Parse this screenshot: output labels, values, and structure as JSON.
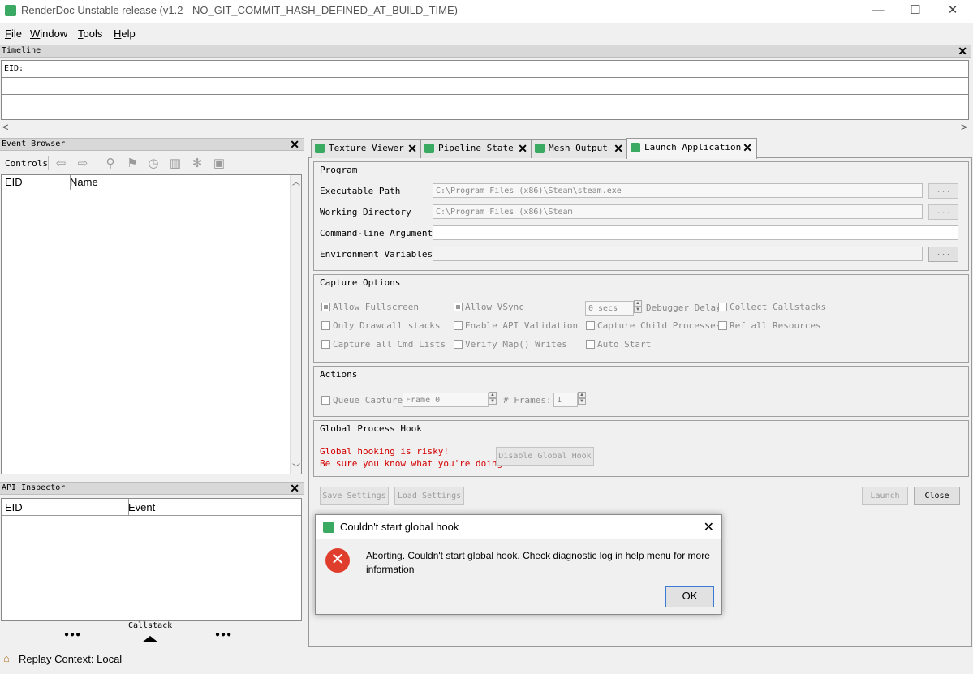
{
  "window": {
    "title": "RenderDoc Unstable release (v1.2 - NO_GIT_COMMIT_HASH_DEFINED_AT_BUILD_TIME)",
    "minimize": "—",
    "maximize": "☐",
    "close": "✕"
  },
  "menu": {
    "file": {
      "mnemonic": "F",
      "rest": "ile"
    },
    "window": {
      "mnemonic": "W",
      "rest": "indow"
    },
    "tools": {
      "mnemonic": "T",
      "rest": "ools"
    },
    "help": {
      "mnemonic": "H",
      "rest": "elp"
    }
  },
  "timeline": {
    "title": "Timeline",
    "eid_label": "EID:",
    "close": "✕",
    "scroll_left": "<",
    "scroll_right": ">"
  },
  "event_browser": {
    "title": "Event Browser",
    "close": "✕",
    "controls_label": "Controls",
    "columns": [
      "EID",
      "Name"
    ]
  },
  "api_inspector": {
    "title": "API Inspector",
    "close": "✕",
    "columns": [
      "EID",
      "Event"
    ],
    "callstack_label": "Callstack",
    "dots": "●●●"
  },
  "tabs": [
    {
      "label": "Texture Viewer",
      "close": "✕"
    },
    {
      "label": "Pipeline State",
      "close": "✕"
    },
    {
      "label": "Mesh Output",
      "close": "✕"
    },
    {
      "label": "Launch Application",
      "close": "✕"
    }
  ],
  "program": {
    "title": "Program",
    "executable_label": "Executable Path",
    "executable_value": "C:\\Program Files (x86)\\Steam\\steam.exe",
    "working_dir_label": "Working Directory",
    "working_dir_value": "C:\\Program Files (x86)\\Steam",
    "cmdline_label": "Command-line Arguments",
    "cmdline_value": "",
    "env_label": "Environment Variables",
    "env_value": "",
    "browse": "..."
  },
  "capture_options": {
    "title": "Capture Options",
    "allow_fullscreen": "Allow Fullscreen",
    "allow_vsync": "Allow VSync",
    "debugger_delay_value": "0 secs",
    "debugger_delay_label": "Debugger Delay",
    "collect_callstacks": "Collect Callstacks",
    "only_drawcall_stacks": "Only Drawcall stacks",
    "enable_api_validation": "Enable API Validation",
    "capture_child_processes": "Capture Child Processes",
    "ref_all_resources": "Ref all Resources",
    "capture_all_cmd_lists": "Capture all Cmd Lists",
    "verify_map_writes": "Verify Map() Writes",
    "auto_start": "Auto Start"
  },
  "actions": {
    "title": "Actions",
    "queue_capture": "Queue Capture",
    "frame_value": "Frame 0",
    "frames_label": "# Frames:",
    "frames_value": "1"
  },
  "global_hook": {
    "title": "Global Process Hook",
    "warning_line1": "Global hooking is risky!",
    "warning_line2": "Be sure you know what you're doing.",
    "disable_button": "Disable Global Hook",
    "warning_color": "#d40000"
  },
  "bottom_buttons": {
    "save_settings": "Save Settings",
    "load_settings": "Load Settings",
    "launch": "Launch",
    "close": "Close"
  },
  "dialog": {
    "title": "Couldn't start global hook",
    "close": "✕",
    "error_icon": "✕",
    "message": "Aborting. Couldn't start global hook. Check diagnostic log in help menu for more information",
    "ok": "OK"
  },
  "status": {
    "text": "Replay Context: Local",
    "icon": "house-icon"
  },
  "colors": {
    "accent": "#3aaa62",
    "error": "#e03e2d"
  }
}
